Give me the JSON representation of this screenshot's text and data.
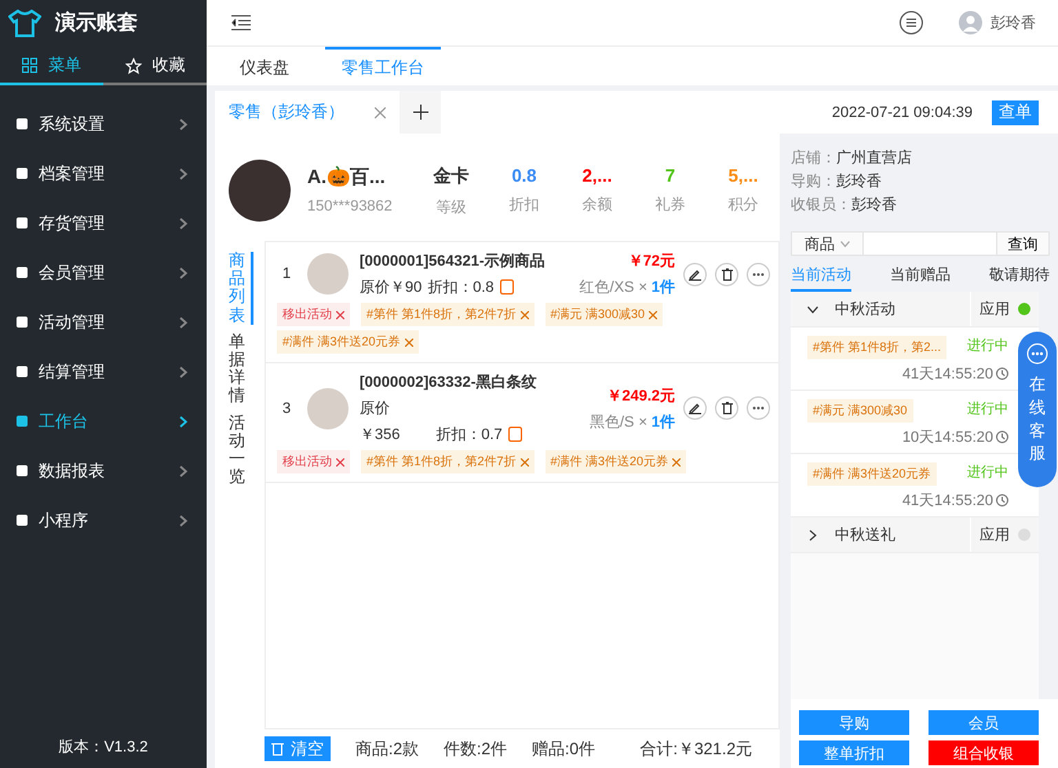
{
  "sidebar": {
    "brand": "演示账套",
    "tabs": [
      {
        "label": "菜单",
        "selected": true,
        "kind": "grid"
      },
      {
        "label": "收藏",
        "selected": false,
        "kind": "star"
      }
    ],
    "items": [
      {
        "label": "系统设置",
        "selected": false
      },
      {
        "label": "档案管理",
        "selected": false
      },
      {
        "label": "存货管理",
        "selected": false
      },
      {
        "label": "会员管理",
        "selected": false
      },
      {
        "label": "活动管理",
        "selected": false
      },
      {
        "label": "结算管理",
        "selected": false
      },
      {
        "label": "工作台",
        "selected": true
      },
      {
        "label": "数据报表",
        "selected": false
      },
      {
        "label": "小程序",
        "selected": false
      }
    ],
    "version": "版本：V1.3.2"
  },
  "topbar": {
    "user": "彭玲香"
  },
  "nav_tabs": [
    {
      "label": "仪表盘",
      "selected": false
    },
    {
      "label": "零售工作台",
      "selected": true
    }
  ],
  "order_tabs": [
    {
      "label": "零售（彭玲香）",
      "selected": true
    }
  ],
  "datetime": "2022-07-21 09:04:39",
  "query_button": "查单",
  "member": {
    "name": "A.🎃百...",
    "phone": "150***93862",
    "stats": [
      {
        "value": "金卡",
        "label": "等级",
        "color": "#333333"
      },
      {
        "value": "0.8",
        "label": "折扣",
        "color": "#3b8cf5"
      },
      {
        "value": "2,...",
        "label": "余额",
        "color": "#ff0000"
      },
      {
        "value": "7",
        "label": "礼券",
        "color": "#52c41a"
      },
      {
        "value": "5,...",
        "label": "积分",
        "color": "#fa8c16"
      }
    ]
  },
  "store_info": [
    {
      "label": "店铺：",
      "value": "广州直营店"
    },
    {
      "label": "导购：",
      "value": "彭玲香"
    },
    {
      "label": "收银员：",
      "value": "彭玲香"
    }
  ],
  "side_tabs": [
    {
      "label": "商品列表",
      "selected": true
    },
    {
      "label": "单据详情",
      "selected": false
    },
    {
      "label": "活动一览",
      "selected": false
    }
  ],
  "products": [
    {
      "index": "1",
      "name": "[0000001]564321-示例商品",
      "lines": [
        [
          "原价￥90",
          "折扣：0.8"
        ]
      ],
      "price": "￥72元",
      "spec": "红色/XS ×",
      "qty": "1件",
      "tags": [
        {
          "label": "移出活动",
          "kind": "remove"
        },
        {
          "label": "#第件 第1件8折，第2件7折",
          "kind": "promo"
        },
        {
          "label": "#满元 满300减30",
          "kind": "promo"
        },
        {
          "label": "#满件 满3件送20元券",
          "kind": "promo"
        }
      ]
    },
    {
      "index": "3",
      "name": "[0000002]63332-黑白条纹",
      "lines": [
        [
          "原价"
        ],
        [
          "￥356",
          "折扣：0.7"
        ]
      ],
      "price": "￥249.2元",
      "spec": "黑色/S ×",
      "qty": "1件",
      "tags": [
        {
          "label": "移出活动",
          "kind": "remove"
        },
        {
          "label": "#第件 第1件8折，第2件7折",
          "kind": "promo"
        },
        {
          "label": "#满件 满3件送20元券",
          "kind": "promo"
        }
      ]
    }
  ],
  "footer": {
    "clear": "清空",
    "summary": [
      "商品:2款",
      "件数:2件",
      "赠品:0件"
    ],
    "total": "合计:￥321.2元"
  },
  "search": {
    "select": "商品",
    "button": "查询"
  },
  "activity_tabs": [
    {
      "label": "当前活动",
      "selected": true
    },
    {
      "label": "当前赠品",
      "selected": false
    },
    {
      "label": "敬请期待",
      "selected": false
    }
  ],
  "groups": [
    {
      "title": "中秋活动",
      "expanded": true,
      "apply": "应用",
      "on": true,
      "items": [
        {
          "tag": "#第件 第1件8折，第2...",
          "status": "进行中",
          "time": "41天14:55:20"
        },
        {
          "tag": "#满元 满300减30",
          "status": "进行中",
          "time": "10天14:55:20"
        },
        {
          "tag": "#满件 满3件送20元券",
          "status": "进行中",
          "time": "41天14:55:20"
        }
      ]
    },
    {
      "title": "中秋送礼",
      "expanded": false,
      "apply": "应用",
      "on": false
    }
  ],
  "actions": [
    {
      "label": "导购",
      "color": "#1890ff"
    },
    {
      "label": "会员",
      "color": "#1890ff"
    },
    {
      "label": "整单折扣",
      "color": "#1890ff"
    },
    {
      "label": "组合收银",
      "color": "#ff0000"
    }
  ],
  "chat": {
    "label": "在线客服"
  }
}
